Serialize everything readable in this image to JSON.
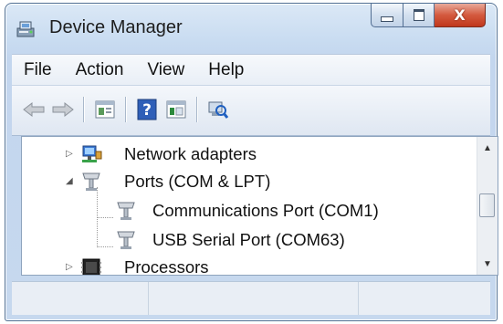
{
  "window": {
    "title": "Device Manager",
    "app_icon": "device-manager-icon",
    "caption_buttons": [
      "minimize",
      "maximize",
      "close"
    ],
    "close_glyph": "X"
  },
  "menu": {
    "items": [
      {
        "label": "File"
      },
      {
        "label": "Action"
      },
      {
        "label": "View"
      },
      {
        "label": "Help"
      }
    ]
  },
  "toolbar": {
    "buttons": [
      "back-arrow-icon",
      "forward-arrow-icon",
      "properties-icon",
      "help-icon",
      "console-tree-icon",
      "scan-hardware-icon"
    ],
    "help_glyph": "?"
  },
  "tree": {
    "items": [
      {
        "label": "Network adapters",
        "expanded": false,
        "icon": "network-adapter-icon"
      },
      {
        "label": "Ports (COM & LPT)",
        "expanded": true,
        "icon": "port-icon"
      },
      {
        "label": "Communications Port (COM1)",
        "icon": "port-icon"
      },
      {
        "label": "USB Serial Port (COM63)",
        "icon": "port-icon"
      },
      {
        "label": "Processors",
        "expanded": false,
        "icon": "processor-icon"
      }
    ]
  },
  "scrollbar": {
    "up_glyph": "▲",
    "down_glyph": "▼"
  },
  "colors": {
    "accent": "#c0371c",
    "frame": "#c6d8ee"
  }
}
